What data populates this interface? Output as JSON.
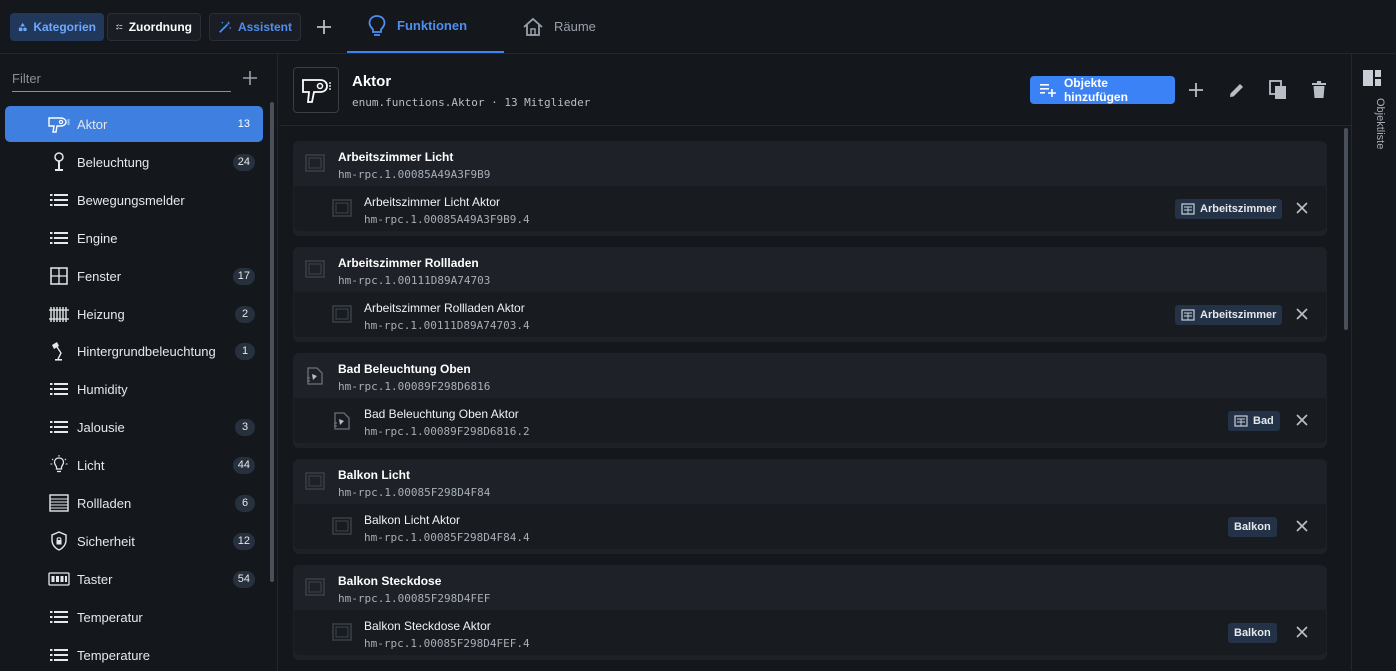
{
  "topbar": {
    "kategorien": "Kategorien",
    "zuordnung": "Zuordnung",
    "assistent": "Assistent",
    "tab_funktionen": "Funktionen",
    "tab_raeume": "Räume"
  },
  "sidebar": {
    "filter_placeholder": "Filter",
    "items": [
      {
        "label": "Aktor",
        "count": "13",
        "icon": "hairdryer-icon"
      },
      {
        "label": "Beleuchtung",
        "count": "24",
        "icon": "lamp-icon"
      },
      {
        "label": "Bewegungsmelder",
        "count": "",
        "icon": "list-icon"
      },
      {
        "label": "Engine",
        "count": "",
        "icon": "list-icon"
      },
      {
        "label": "Fenster",
        "count": "17",
        "icon": "window-icon"
      },
      {
        "label": "Heizung",
        "count": "2",
        "icon": "radiator-icon"
      },
      {
        "label": "Hintergrundbeleuchtung",
        "count": "1",
        "icon": "desk-lamp-icon"
      },
      {
        "label": "Humidity",
        "count": "",
        "icon": "list-icon"
      },
      {
        "label": "Jalousie",
        "count": "3",
        "icon": "list-icon"
      },
      {
        "label": "Licht",
        "count": "44",
        "icon": "bulb-icon"
      },
      {
        "label": "Rollladen",
        "count": "6",
        "icon": "shutter-icon"
      },
      {
        "label": "Sicherheit",
        "count": "12",
        "icon": "shield-lock-icon"
      },
      {
        "label": "Taster",
        "count": "54",
        "icon": "keypad-icon"
      },
      {
        "label": "Temperatur",
        "count": "",
        "icon": "list-icon"
      },
      {
        "label": "Temperature",
        "count": "",
        "icon": "list-icon"
      }
    ]
  },
  "header": {
    "title": "Aktor",
    "subtitle": "enum.functions.Aktor · 13 Mitglieder",
    "add_button": "Objekte hinzufügen"
  },
  "groups": [
    {
      "title": "Arbeitszimmer Licht",
      "id": "hm-rpc.1.00085A49A3F9B9",
      "child_title": "Arbeitszimmer Licht Aktor",
      "child_id": "hm-rpc.1.00085A49A3F9B9.4",
      "room": "Arbeitszimmer"
    },
    {
      "title": "Arbeitszimmer Rollladen",
      "id": "hm-rpc.1.00111D89A74703",
      "child_title": "Arbeitszimmer Rollladen Aktor",
      "child_id": "hm-rpc.1.00111D89A74703.4",
      "room": "Arbeitszimmer"
    },
    {
      "title": "Bad Beleuchtung Oben",
      "id": "hm-rpc.1.00089F298D6816",
      "child_title": "Bad Beleuchtung Oben Aktor",
      "child_id": "hm-rpc.1.00089F298D6816.2",
      "room": "Bad"
    },
    {
      "title": "Balkon Licht",
      "id": "hm-rpc.1.00085F298D4F84",
      "child_title": "Balkon Licht Aktor",
      "child_id": "hm-rpc.1.00085F298D4F84.4",
      "room": "Balkon"
    },
    {
      "title": "Balkon Steckdose",
      "id": "hm-rpc.1.00085F298D4FEF",
      "child_title": "Balkon Steckdose Aktor",
      "child_id": "hm-rpc.1.00085F298D4FEF.4",
      "room": "Balkon"
    }
  ],
  "rail": {
    "label": "Objektliste"
  },
  "colors": {
    "accent": "#3b82f6",
    "background": "#14171c",
    "card": "#1e2228"
  }
}
